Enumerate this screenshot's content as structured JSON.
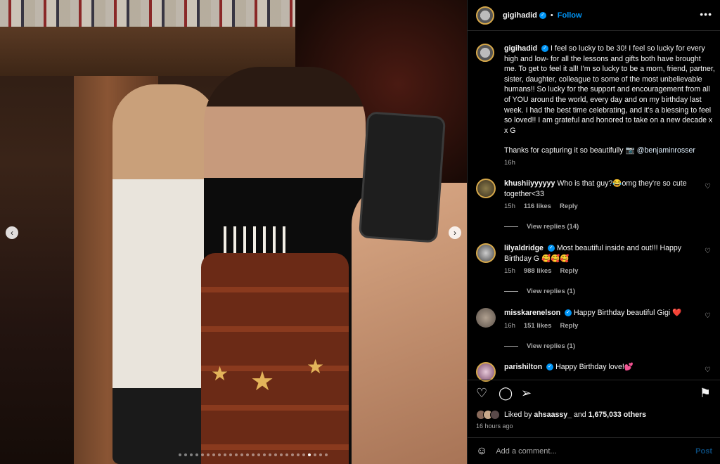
{
  "header": {
    "username": "gigihadid",
    "follow_label": "Follow",
    "more_icon": "•••"
  },
  "caption": {
    "username": "gigihadid",
    "text": "I feel so lucky to be 30! I feel so lucky for every high and low- for all the lessons and gifts both have brought me. To get to feel it all! I'm so lucky to be a mom, friend, partner, sister, daughter, colleague to some of the most unbelievable humans!! So lucky for the support and encouragement from all of YOU around the world, every day and on my birthday last week. I had the best time celebrating, and it's a blessing to feel so loved!! I am grateful and honored to take on a new decade x x G",
    "thanks": "Thanks for capturing it so beautifully 📷",
    "mention": "@benjaminrosser",
    "age": "16h"
  },
  "comments": [
    {
      "username": "khushiiyyyyyy",
      "text": "Who is that guy?😂omg they're so cute together<33",
      "age": "15h",
      "likes": "116 likes",
      "reply": "Reply",
      "view_replies": "View replies (14)"
    },
    {
      "username": "lilyaldridge",
      "text": "Most beautiful inside and out!!! Happy Birthday G 🥰🥰🥰",
      "age": "15h",
      "likes": "988 likes",
      "reply": "Reply",
      "view_replies": "View replies (1)"
    },
    {
      "username": "misskarenelson",
      "text": "Happy Birthday beautiful Gigi ❤️",
      "age": "16h",
      "likes": "151 likes",
      "reply": "Reply",
      "view_replies": "View replies (1)"
    },
    {
      "username": "parishilton",
      "text": "Happy Birthday love!💕"
    }
  ],
  "likes_bar": {
    "prefix": "Liked by",
    "user": "ahsaassy_",
    "and": "and",
    "count": "1,675,033 others"
  },
  "timestamp": "16 hours ago",
  "add_comment": {
    "placeholder": "Add a comment...",
    "post_label": "Post"
  },
  "colors": {
    "accent": "#0095f6",
    "background": "#000000",
    "muted": "#a8a8a8"
  }
}
